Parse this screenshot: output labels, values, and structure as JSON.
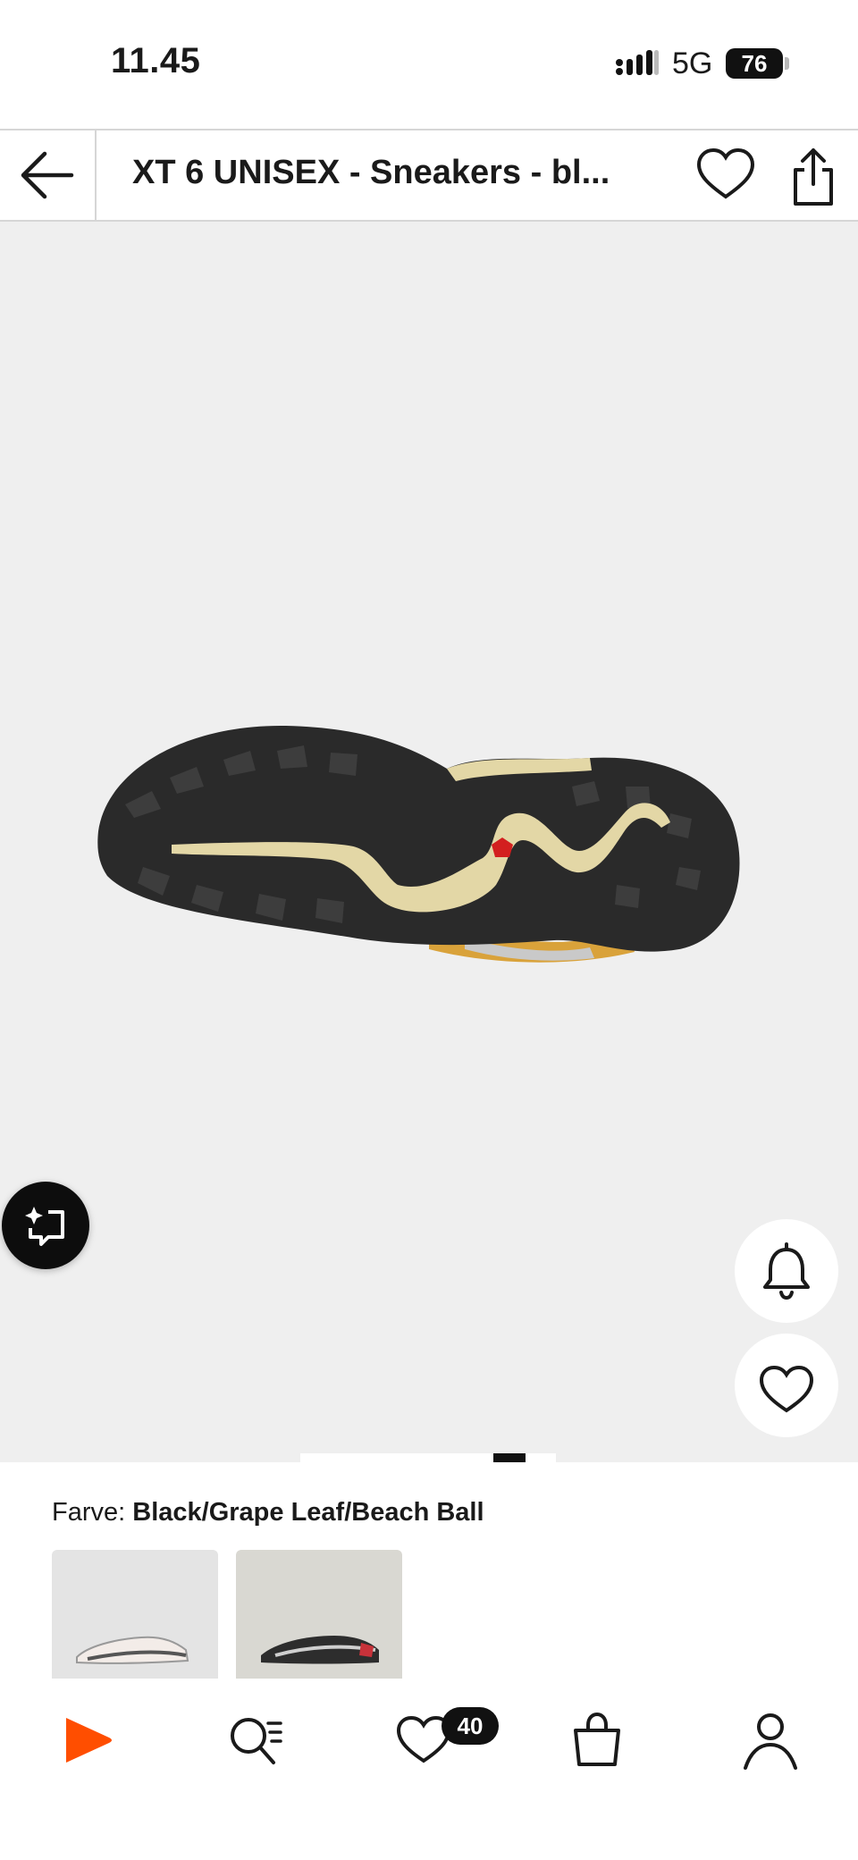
{
  "status_bar": {
    "time": "11.45",
    "network": "5G",
    "battery": "76"
  },
  "header": {
    "title": "XT 6 UNISEX - Sneakers - bl..."
  },
  "product": {
    "color_label": "Farve:",
    "color_value": "Black/Grape Leaf/Beach Ball",
    "image_count": 2,
    "active_image": 2
  },
  "bottom_nav": {
    "items": [
      "home",
      "search",
      "wishlist",
      "bag",
      "profile"
    ],
    "wishlist_count": "40"
  },
  "colors": {
    "brand": "#ff4e00",
    "dark": "#111111",
    "image_bg": "#efefef"
  }
}
